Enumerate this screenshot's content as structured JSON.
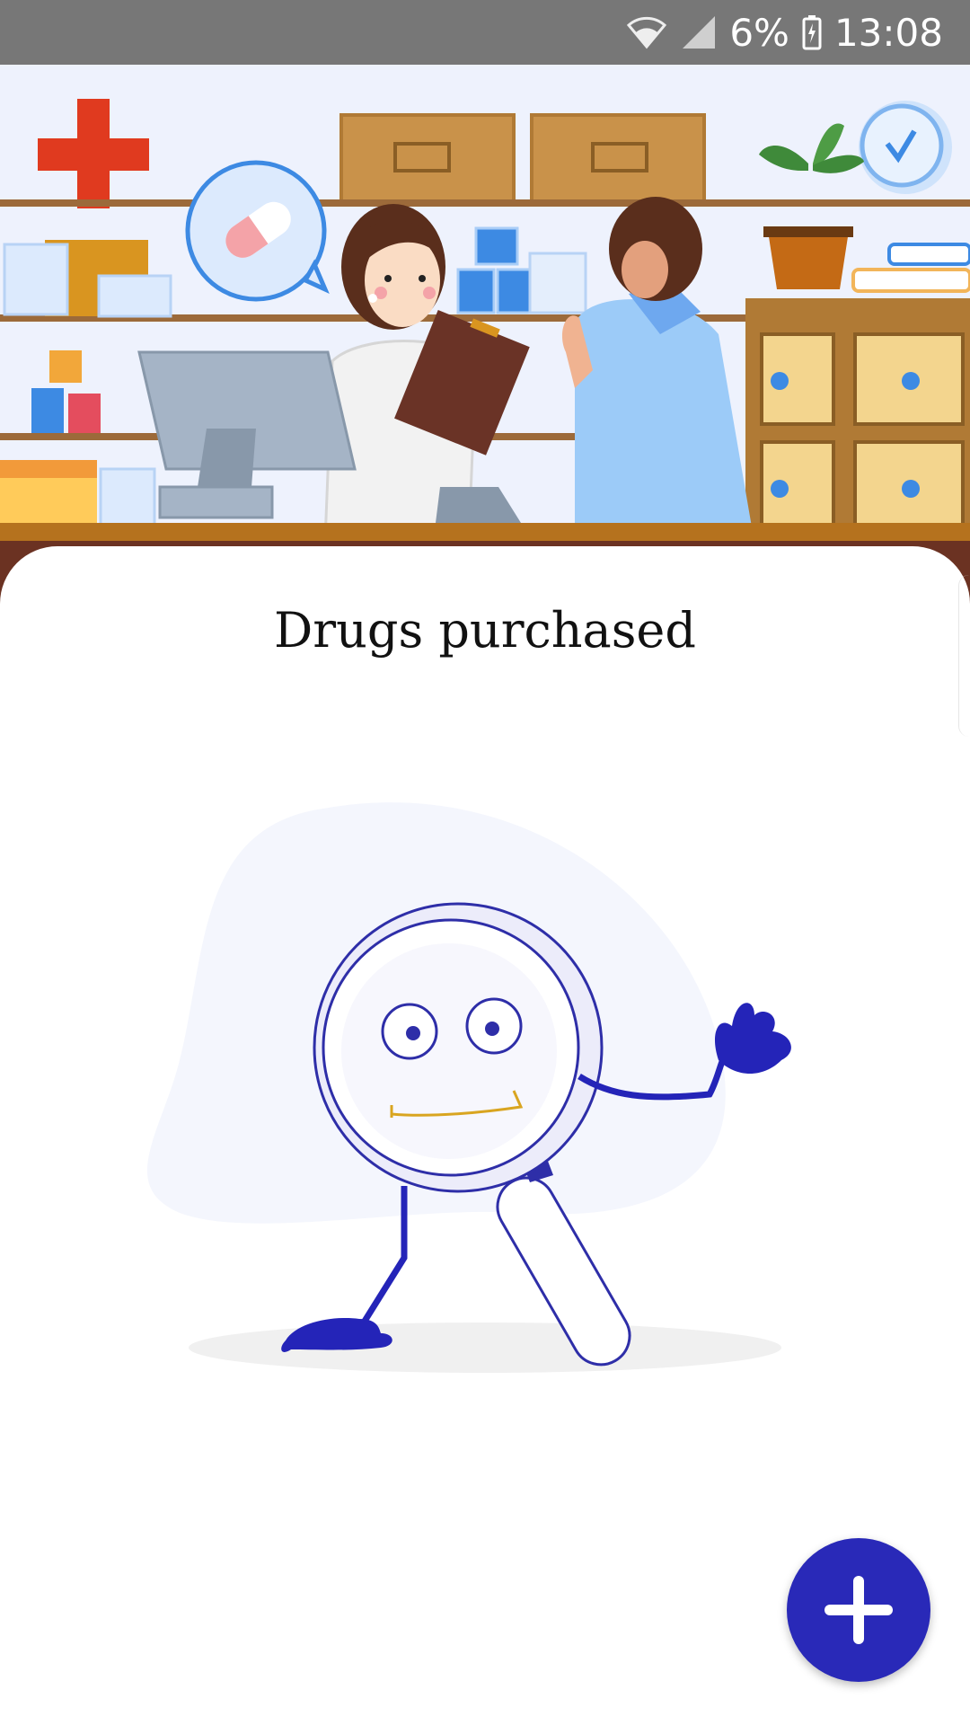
{
  "status_bar": {
    "battery": "6%",
    "time": "13:08",
    "icons": [
      "wifi-icon",
      "signal-icon",
      "battery-icon"
    ]
  },
  "hero": {
    "illustration": "pharmacy-counter-illustration"
  },
  "main": {
    "title": "Drugs purchased",
    "empty_illustration": "magnifier-character-illustration"
  },
  "fab": {
    "icon": "plus-icon"
  },
  "colors": {
    "status_bar_bg": "#777777",
    "accent": "#2929b8",
    "cross_red": "#e03a1f"
  }
}
